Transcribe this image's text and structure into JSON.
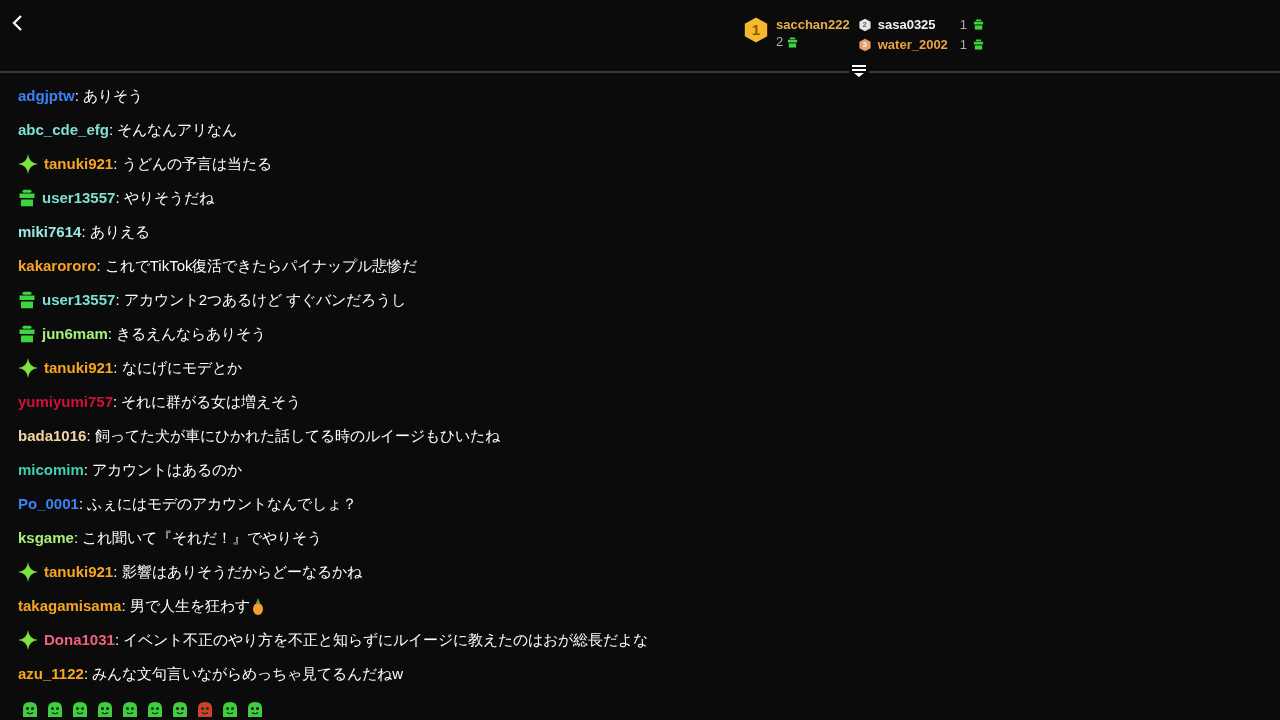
{
  "leaderboard": [
    {
      "rank": "1",
      "name": "sacchan222",
      "count": "2",
      "color": "#e8b04a"
    },
    {
      "rank": "2",
      "name": "sasa0325",
      "count": "1",
      "color": "#f2f2f2"
    },
    {
      "rank": "3",
      "name": "water_2002",
      "count": "1",
      "color": "#f0a040"
    }
  ],
  "messages": [
    {
      "kind": "plain",
      "user": "adgjptw",
      "sep": ":",
      "color": "#3b82f6",
      "text": "ありそう"
    },
    {
      "kind": "plain",
      "user": "abc_cde_efg",
      "sep": ":",
      "color": "#7fe0d0",
      "text": "そんなんアリなん"
    },
    {
      "kind": "sparkle",
      "user": "tanuki921",
      "sep": ":",
      "color": "#f5a623",
      "text": "うどんの予言は当たる"
    },
    {
      "kind": "gift",
      "user": "user13557",
      "sep": ":",
      "color": "#7fe0d0",
      "text": "やりそうだね"
    },
    {
      "kind": "plain",
      "user": "miki7614",
      "sep": ":",
      "color": "#9be8e0",
      "text": "ありえる"
    },
    {
      "kind": "plain",
      "user": "kakarororo",
      "sep": ":",
      "color": "#f5a623",
      "text": "これでTikTok復活できたらパイナップル悲惨だ"
    },
    {
      "kind": "gift",
      "user": "user13557",
      "sep": ":",
      "color": "#7fe0d0",
      "text": "アカウント2つあるけど すぐバンだろうし"
    },
    {
      "kind": "gift",
      "user": "jun6mam",
      "sep": ":",
      "color": "#a6f07a",
      "text": "きるえんならありそう"
    },
    {
      "kind": "sparkle",
      "user": "tanuki921",
      "sep": ":",
      "color": "#f5a623",
      "text": "なにげにモデとか"
    },
    {
      "kind": "plain",
      "user": "yumiyumi757",
      "sep": ":",
      "color": "#d0103a",
      "text": "それに群がる女は増えそう"
    },
    {
      "kind": "plain",
      "user": "bada1016",
      "sep": ":",
      "color": "#f5d5a0",
      "text": "飼ってた犬が車にひかれた話してる時のルイージもひいたね"
    },
    {
      "kind": "plain",
      "user": "micomim",
      "sep": ":",
      "color": "#40d0b0",
      "text": "アカウントはあるのか"
    },
    {
      "kind": "plain",
      "user": "Po_0001",
      "sep": ":",
      "color": "#3b82f6",
      "text": "ふぇにはモデのアカウントなんでしょ？"
    },
    {
      "kind": "plain",
      "user": "ksgame",
      "sep": ":",
      "color": "#a6f07a",
      "text": "これ聞いて『それだ！』でやりそう"
    },
    {
      "kind": "sparkle",
      "user": "tanuki921",
      "sep": ":",
      "color": "#f5a623",
      "text": "影響はありそうだからどーなるかね"
    },
    {
      "kind": "plain",
      "user": "takagamisama",
      "sep": ":",
      "color": "#f5a623",
      "text": "男で人生を狂わす",
      "emote": true
    },
    {
      "kind": "sparkle",
      "user": "Dona1031",
      "sep": ":",
      "color": "#f06080",
      "text": "イベント不正のやり方を不正と知らずにルイージに教えたのはおが総長だよな"
    },
    {
      "kind": "plain",
      "user": "azu_1122",
      "sep": ":",
      "color": "#f5a623",
      "text": "みんな文句言いながらめっちゃ見てるんだねw"
    }
  ]
}
